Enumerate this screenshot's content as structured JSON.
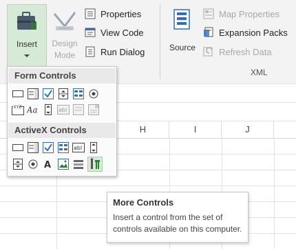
{
  "ribbon": {
    "insert_label": "Insert",
    "design_mode_line1": "Design",
    "design_mode_line2": "Mode",
    "properties_label": "Properties",
    "view_code_label": "View Code",
    "run_dialog_label": "Run Dialog",
    "source_label": "Source",
    "map_properties_label": "Map Properties",
    "expansion_packs_label": "Expansion Packs",
    "refresh_data_label": "Refresh Data",
    "xml_group_label": "XML"
  },
  "dropdown": {
    "form_controls_header": "Form Controls",
    "activex_controls_header": "ActiveX Controls",
    "form_row1": [
      "button-icon",
      "combo-box-icon",
      "check-box-icon",
      "spin-button-icon",
      "list-box-icon",
      "option-button-icon"
    ],
    "form_row2": [
      "group-box-icon",
      "label-icon",
      "scroll-bar-icon",
      "text-field-icon",
      "combo-list-icon",
      "combo-drop-icon"
    ],
    "activex_row1": [
      "command-button-icon",
      "combo-box-icon",
      "check-box-icon",
      "list-box-icon",
      "text-box-icon",
      "scroll-bar-icon"
    ],
    "activex_row2": [
      "spin-button-icon",
      "option-button-icon",
      "label-icon",
      "image-icon",
      "toggle-button-icon",
      "more-controls-icon"
    ]
  },
  "sheet": {
    "columns": [
      "H",
      "I",
      "J"
    ]
  },
  "tooltip": {
    "title": "More Controls",
    "body_line1": "Insert a control from the set of",
    "body_line2": "controls available on this computer."
  },
  "colors": {
    "ribbon_bg": "#f3f3f3",
    "selected_button_bg": "#d6ead7",
    "accent_blue": "#2f6fbf",
    "accent_green": "#2e7d32"
  }
}
